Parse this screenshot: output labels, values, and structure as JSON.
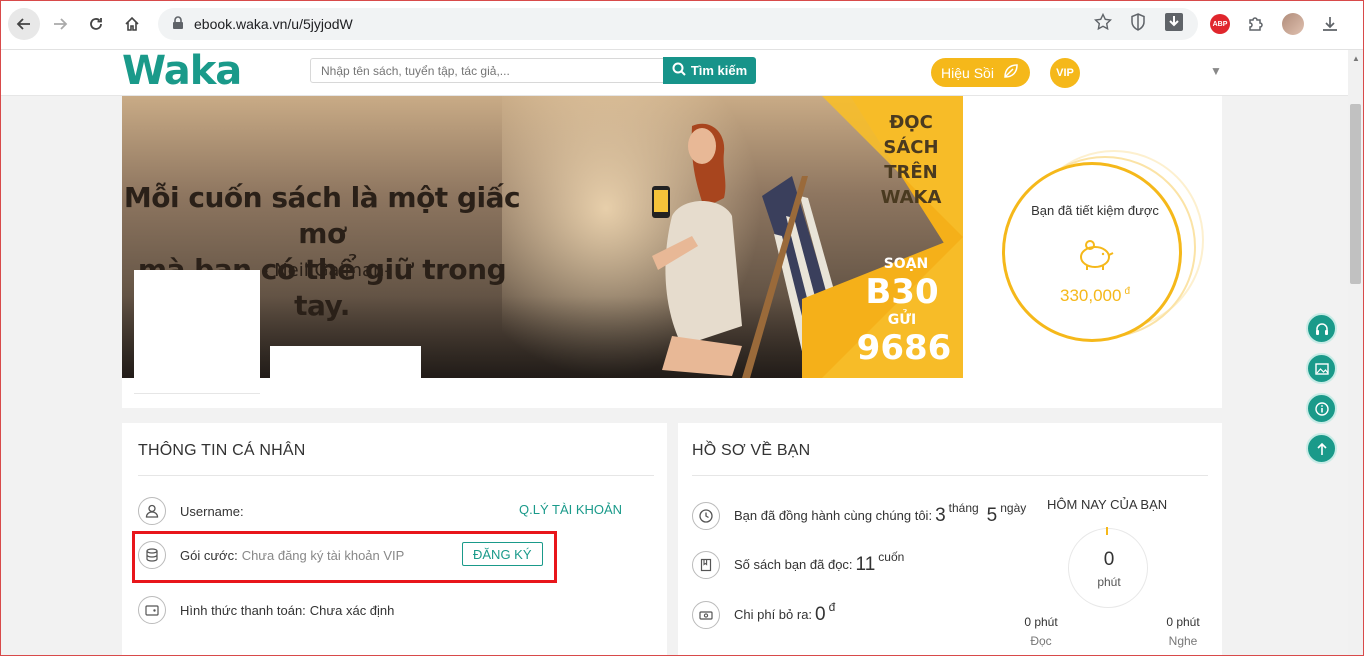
{
  "browser": {
    "url": "ebook.waka.vn/u/5jyjodW",
    "abp_label": "ABP"
  },
  "header": {
    "logo": "Waka",
    "search_placeholder": "Nhập tên sách, tuyển tập, tác giả,...",
    "search_button": "Tìm kiếm",
    "bookstore_button": "Hiệu Sồi",
    "vip_badge": "VIP"
  },
  "banner": {
    "quote_line1": "Mỗi cuốn sách là một giấc mơ",
    "quote_line2": "mà bạn có thể giữ trong tay.",
    "quote_author": "- Neil Gaiman-",
    "promo_line1": "ĐỌC SÁCH",
    "promo_line2": "TRÊN",
    "promo_line3": "WAKA",
    "promo_soan": "SOẠN",
    "promo_code": "B30",
    "promo_gui": "GỬI",
    "promo_number": "9686"
  },
  "savings": {
    "label": "Bạn đã tiết kiệm được",
    "value": "330,000",
    "unit": "đ"
  },
  "personal_info": {
    "title": "THÔNG TIN CÁ NHÂN",
    "username_label": "Username:",
    "manage_account_link": "Q.LÝ TÀI KHOẢN",
    "plan_label": "Gói cước:",
    "plan_value": "Chưa đăng ký tài khoản VIP",
    "register_button": "ĐĂNG KÝ",
    "payment_label": "Hình thức thanh toán:",
    "payment_value": "Chưa xác định"
  },
  "profile": {
    "title": "HỒ SƠ VỀ BẠN",
    "days_label": "Bạn đã đồng hành cùng chúng tôi:",
    "months_value": "3",
    "months_unit": "tháng",
    "days_value": "5",
    "days_unit": "ngày",
    "books_label": "Số sách bạn đã đọc:",
    "books_value": "11",
    "books_unit": "cuốn",
    "cost_label": "Chi phí bỏ ra:",
    "cost_value": "0",
    "cost_unit": "đ",
    "today_title": "HÔM NAY CỦA BẠN",
    "today_value": "0",
    "today_unit": "phút",
    "read_value": "0 phút",
    "read_label": "Đọc",
    "listen_value": "0 phút",
    "listen_label": "Nghe"
  }
}
